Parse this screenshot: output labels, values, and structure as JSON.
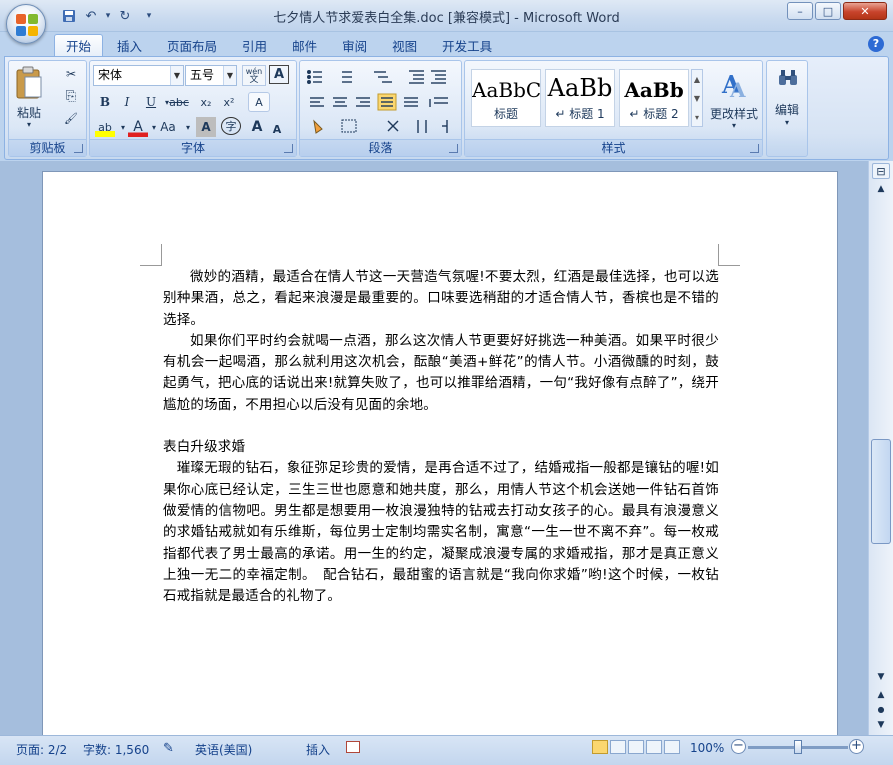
{
  "window": {
    "title": "七夕情人节求爱表白全集.doc [兼容模式] - Microsoft Word",
    "minimize": "–",
    "maximize": "□",
    "close": "✕"
  },
  "qat": {
    "save": "💾",
    "undo": "↶",
    "redo": "↻",
    "customize": "▾"
  },
  "tabs": [
    "开始",
    "插入",
    "页面布局",
    "引用",
    "邮件",
    "审阅",
    "视图",
    "开发工具"
  ],
  "help": "?",
  "ribbon": {
    "clipboard": {
      "label": "剪贴板",
      "paste": "粘贴",
      "cut": "✂",
      "copy": "⎘",
      "format_painter": "🖌"
    },
    "font": {
      "label": "字体",
      "font_name": "宋体",
      "font_size": "五号",
      "bold": "B",
      "italic": "I",
      "underline": "U",
      "strike": "abc",
      "subscript": "x₂",
      "superscript": "x²",
      "clear_format": "A",
      "highlight": "ab",
      "font_color": "A",
      "change_case": "Aa",
      "grow": "A",
      "shrink": "A",
      "phonetic": "文",
      "border": "A",
      "enclose": "字"
    },
    "paragraph": {
      "label": "段落"
    },
    "styles": {
      "label": "样式",
      "tiles": [
        {
          "sample": "AaBbC",
          "name": "标题"
        },
        {
          "sample": "AaBb",
          "name": "↵ 标题 1"
        },
        {
          "sample": "AaBb",
          "name": "↵ 标题 2"
        }
      ],
      "change_styles": "更改样式"
    },
    "editing": {
      "label": "编辑"
    }
  },
  "document": {
    "paragraphs": [
      {
        "style": "indent",
        "text": "微妙的酒精，最适合在情人节这一天营造气氛喔!不要太烈，红酒是最佳选择，也可以选别种果酒，总之，看起来浪漫是最重要的。口味要选稍甜的才适合情人节，香槟也是不错的选择。"
      },
      {
        "style": "indent",
        "text": "如果你们平时约会就喝一点酒，那么这次情人节更要好好挑选一种美酒。如果平时很少有机会一起喝酒，那么就利用这次机会，酝酿“美酒+鲜花”的情人节。小酒微醺的时刻，鼓起勇气，把心底的话说出来!就算失败了，也可以推罪给酒精，一句“我好像有点醉了”，绕开尴尬的场面，不用担心以后没有见面的余地。"
      },
      {
        "style": "blank",
        "text": ""
      },
      {
        "style": "plain",
        "text": "表白升级求婚"
      },
      {
        "style": "plain",
        "text": "　璀璨无瑕的钻石，象征弥足珍贵的爱情，是再合适不过了，结婚戒指一般都是镶钻的喔!如果你心底已经认定，三生三世也愿意和她共度，那么，用情人节这个机会送她一件钻石首饰做爱情的信物吧。男生都是想要用一枚浪漫独特的钻戒去打动女孩子的心。最具有浪漫意义的求婚钻戒就如有乐维斯，每位男士定制均需实名制，寓意“一生一世不离不弃”。每一枚戒指都代表了男士最高的承诺。用一生的约定，凝聚成浪漫专属的求婚戒指，那才是真正意义上独一无二的幸福定制。　配合钻石，最甜蜜的语言就是“我向你求婚”哟!这个时候，一枚钻石戒指就是最适合的礼物了。"
      }
    ]
  },
  "statusbar": {
    "page": "页面: 2/2",
    "words": "字数: 1,560",
    "language": "英语(美国)",
    "insert_mode": "插入",
    "zoom": "100%",
    "zoom_out": "−",
    "zoom_in": "+"
  }
}
